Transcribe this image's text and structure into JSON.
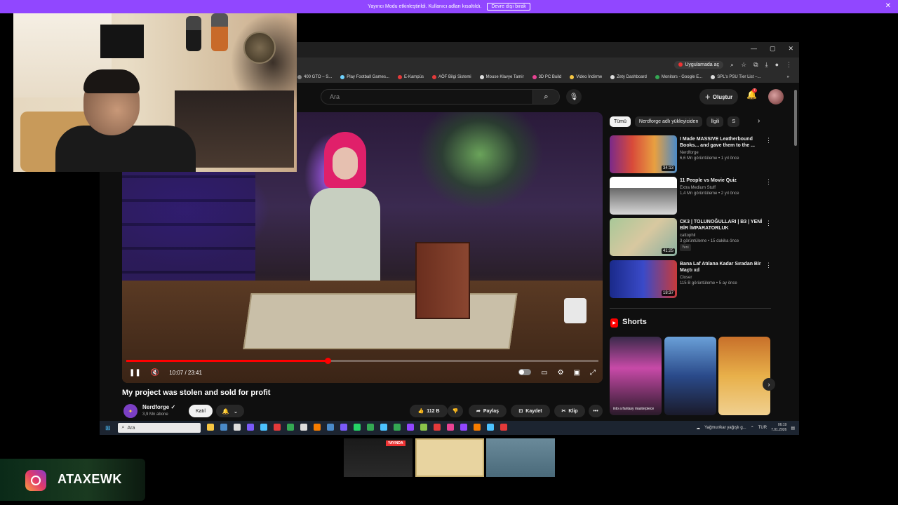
{
  "streamer_bar": {
    "message": "Yayıncı Modu etkinleştirildi. Kullanıcı adları kısaltıldı.",
    "disable_label": "Devre dışı bırak",
    "close_glyph": "✕"
  },
  "browser": {
    "window_controls": [
      "—",
      "▢",
      "✕"
    ],
    "open_in_app_label": "Uygulamada aç",
    "bookmarks": [
      {
        "label": "400 GTO – S...",
        "color": "#888888"
      },
      {
        "label": "Play Football Games...",
        "color": "#6fd3ff"
      },
      {
        "label": "E-Kampüs",
        "color": "#e33a3a"
      },
      {
        "label": "AÖF Bilgi Sistemi",
        "color": "#e33a3a"
      },
      {
        "label": "Mouse Klavye Tamir",
        "color": "#dddddd"
      },
      {
        "label": "3D PC Build",
        "color": "#e84393"
      },
      {
        "label": "Video İndirme",
        "color": "#f5c542"
      },
      {
        "label": "Zety Dashboard",
        "color": "#dddddd"
      },
      {
        "label": "Monitors - Google E...",
        "color": "#34a853"
      },
      {
        "label": "SPL's PSU Tier List –...",
        "color": "#dddddd"
      }
    ],
    "bookmarks_more": "»"
  },
  "youtube": {
    "search_placeholder": "Ara",
    "create_label": "Oluştur",
    "notification_count": "7",
    "player": {
      "time": "10:07 / 23:41",
      "progress_fraction": 0.427
    },
    "video": {
      "title": "My project was stolen and sold for profit",
      "channel": "Nerdforge",
      "subscribers": "3,9 Mn abone",
      "join_label": "Katıl",
      "like_count": "112 B",
      "share_label": "Paylaş",
      "save_label": "Kaydet",
      "clip_label": "Klip",
      "more_glyph": "•••"
    },
    "filters": [
      "Tümü",
      "Nerdforge adlı yükleyiciden",
      "İlgili",
      "S"
    ],
    "recommendations": [
      {
        "title": "I Made MASSIVE Leatherbound Books... and gave them to the ...",
        "channel": "Nerdforge",
        "stats": "6,6 Mn görüntüleme • 1 yıl önce",
        "duration": "34:13",
        "thumb_bg": "linear-gradient(90deg,#7a2a8a,#d84a3a,#e8a040,#4a8ac8)"
      },
      {
        "title": "11 People vs Movie Quiz",
        "channel": "Extra Medium Stuff",
        "stats": "1,4 Mn görüntüleme • 2 yıl önce",
        "duration": "",
        "thumb_bg": "linear-gradient(180deg,#ffffff 0 30%,#6a6a6a 30%,#d8d8d8 100%)"
      },
      {
        "title": "CK3 | TOLUNOĞULLARI | B3 | YENİ BİR İMPARATORLUK",
        "channel": "cattophil",
        "stats": "3 görüntüleme • 15 dakika önce",
        "badge": "Yeni",
        "duration": "41:25",
        "thumb_bg": "linear-gradient(135deg,#a8c898,#d8c8a0 50%,#8ab0a0)"
      },
      {
        "title": "Bana Laf Atılana Kadar Sıradan Bir Maçtı xd",
        "channel": "Closer",
        "stats": "115 B görüntüleme • 5 ay önce",
        "duration": "18:37",
        "thumb_bg": "linear-gradient(90deg,#1a2a8a,#3a4ac8 50%,#c83a3a)"
      }
    ],
    "shorts_label": "Shorts",
    "shorts": [
      {
        "caption": "into a fantasy masterpiece",
        "bg": "linear-gradient(180deg,#3a2a4a,#c84aa8 40%,#2a1a2a)"
      },
      {
        "caption": "",
        "bg": "linear-gradient(180deg,#6aa0d8,#2a4a8a 50%,#1a1a2a)"
      },
      {
        "caption": "",
        "bg": "linear-gradient(180deg,#c8702a,#e8b04a 50%,#f0d090)"
      }
    ]
  },
  "taskbar": {
    "search_placeholder": "Ara",
    "weather": "Yağmur/kar yağışlı g...",
    "language": "TUR",
    "time": "06:19",
    "date": "7.01.2026",
    "apps": [
      "#f5c542",
      "#4a8ac8",
      "#dddddd",
      "#7a5af8",
      "#4cc2ff",
      "#e33a3a",
      "#34a853",
      "#dddddd",
      "#f57c00",
      "#4a8ac8",
      "#7a5af8",
      "#25d366",
      "#34a853",
      "#4cc2ff",
      "#34a853",
      "#9147ff",
      "#8bc34a",
      "#e33a3a",
      "#e84393",
      "#9147ff",
      "#f57c00",
      "#4cc2ff",
      "#e33a3a"
    ]
  },
  "overlay": {
    "live_label": "YAYINDA",
    "instagram_handle": "ATAXEWK"
  }
}
